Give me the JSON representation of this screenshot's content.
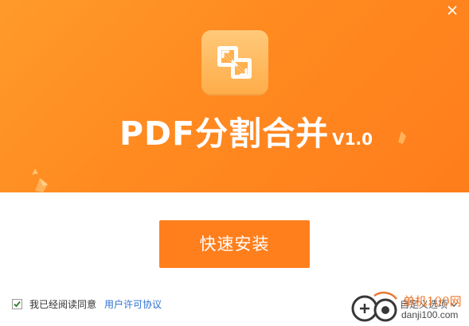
{
  "window": {
    "close_icon": "close-icon"
  },
  "header": {
    "logo_icon": "pdf-split-merge-icon",
    "title": "PDF分割合并",
    "version": "V1.0",
    "accent_color": "#ff8a20"
  },
  "main": {
    "install_button_label": "快速安装"
  },
  "footer": {
    "agree_checked": true,
    "agree_text": "我已经阅读同意",
    "license_link": "用户许可协议",
    "custom_label": "自定义选项",
    "custom_icon": "chevron-down-icon"
  },
  "watermark": {
    "site_name": "单机100网",
    "site_url": "danji100.com"
  }
}
